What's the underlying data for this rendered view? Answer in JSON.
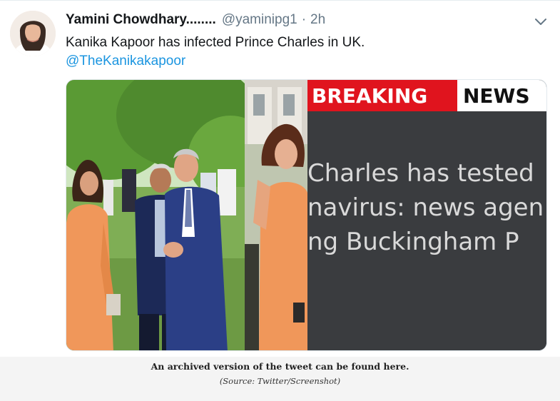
{
  "tweet": {
    "display_name": "Yamini Chowdhary........",
    "handle": "@yaminipg1",
    "separator": "·",
    "time": "2h",
    "text": "Kanika Kapoor has infected Prince Charles in UK.",
    "mention": "@TheKanikakapoor"
  },
  "media": {
    "banner_left": "BREAKING",
    "banner_right": "NEWS",
    "ticker_lines": [
      "Charles has tested",
      "navirus: news agen",
      "ng Buckingham P"
    ],
    "colors": {
      "banner_red": "#e0141e",
      "panel_dark": "#3a3c3f",
      "dress_orange": "#f0975a",
      "suit_navy": "#1f2e5c",
      "foliage_green": "#4f8a2e"
    }
  },
  "caption": {
    "main": "An archived version of the tweet can be found here.",
    "source": "(Source: Twitter/Screenshot)"
  },
  "icons": {
    "menu": "chevron-down-icon",
    "avatar": "avatar-photo"
  }
}
